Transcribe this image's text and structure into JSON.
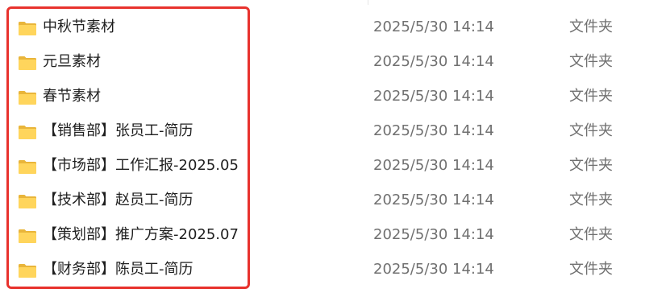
{
  "highlight_color": "#e8322d",
  "folder_icon": "folder-icon",
  "files": [
    {
      "name": "中秋节素材",
      "modified": "2025/5/30 14:14",
      "type": "文件夹"
    },
    {
      "name": "元旦素材",
      "modified": "2025/5/30 14:14",
      "type": "文件夹"
    },
    {
      "name": "春节素材",
      "modified": "2025/5/30 14:14",
      "type": "文件夹"
    },
    {
      "name": "【销售部】张员工-简历",
      "modified": "2025/5/30 14:14",
      "type": "文件夹"
    },
    {
      "name": "【市场部】工作汇报-2025.05",
      "modified": "2025/5/30 14:14",
      "type": "文件夹"
    },
    {
      "name": "【技术部】赵员工-简历",
      "modified": "2025/5/30 14:14",
      "type": "文件夹"
    },
    {
      "name": "【策划部】推广方案-2025.07",
      "modified": "2025/5/30 14:14",
      "type": "文件夹"
    },
    {
      "name": "【财务部】陈员工-简历",
      "modified": "2025/5/30 14:14",
      "type": "文件夹"
    }
  ]
}
